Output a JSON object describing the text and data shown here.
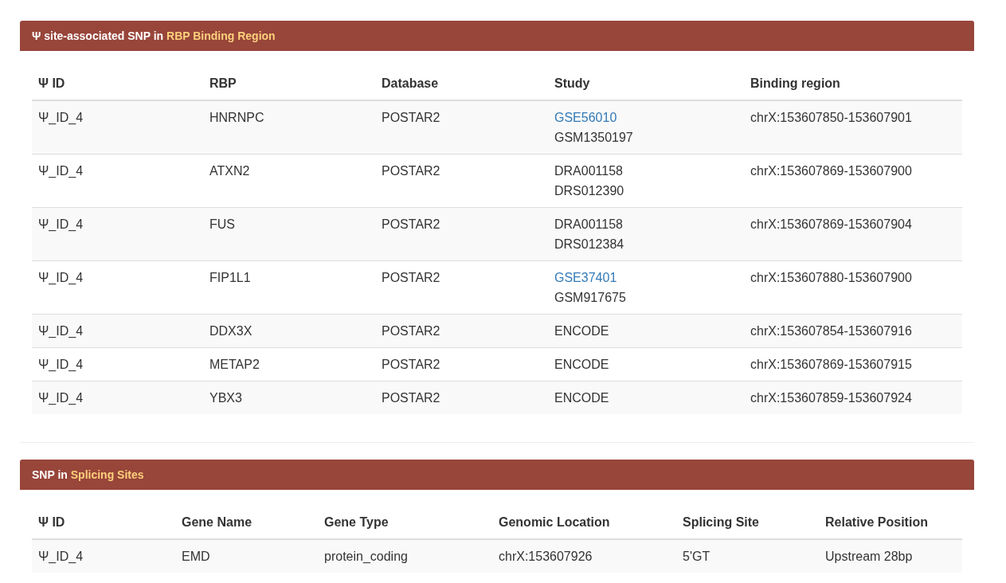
{
  "panels": [
    {
      "title": "Ψ site-associated SNP in ",
      "title_highlight": "RBP Binding Region",
      "table": {
        "columns": [
          "Ψ ID",
          "RBP",
          "Database",
          "Study",
          "Binding region"
        ],
        "rows": [
          [
            "Ψ_ID_4",
            "HNRNPC",
            "POSTAR2",
            {
              "lines": [
                {
                  "text": "GSE56010",
                  "link": true
                },
                {
                  "text": "GSM1350197",
                  "link": false
                }
              ]
            },
            "chrX:153607850-153607901"
          ],
          [
            "Ψ_ID_4",
            "ATXN2",
            "POSTAR2",
            {
              "lines": [
                {
                  "text": "DRA001158",
                  "link": false
                },
                {
                  "text": "DRS012390",
                  "link": false
                }
              ]
            },
            "chrX:153607869-153607900"
          ],
          [
            "Ψ_ID_4",
            "FUS",
            "POSTAR2",
            {
              "lines": [
                {
                  "text": "DRA001158",
                  "link": false
                },
                {
                  "text": "DRS012384",
                  "link": false
                }
              ]
            },
            "chrX:153607869-153607904"
          ],
          [
            "Ψ_ID_4",
            "FIP1L1",
            "POSTAR2",
            {
              "lines": [
                {
                  "text": "GSE37401",
                  "link": true
                },
                {
                  "text": "GSM917675",
                  "link": false
                }
              ]
            },
            "chrX:153607880-153607900"
          ],
          [
            "Ψ_ID_4",
            "DDX3X",
            "POSTAR2",
            "ENCODE",
            "chrX:153607854-153607916"
          ],
          [
            "Ψ_ID_4",
            "METAP2",
            "POSTAR2",
            "ENCODE",
            "chrX:153607869-153607915"
          ],
          [
            "Ψ_ID_4",
            "YBX3",
            "POSTAR2",
            "ENCODE",
            "chrX:153607859-153607924"
          ]
        ]
      }
    },
    {
      "title": "SNP in ",
      "title_highlight": "Splicing Sites",
      "table": {
        "columns": [
          "Ψ ID",
          "Gene Name",
          "Gene Type",
          "Genomic Location",
          "Splicing Site",
          "Relative Position"
        ],
        "rows": [
          [
            "Ψ_ID_4",
            "EMD",
            "protein_coding",
            "chrX:153607926",
            "5'GT",
            "Upstream 28bp"
          ]
        ]
      }
    }
  ]
}
